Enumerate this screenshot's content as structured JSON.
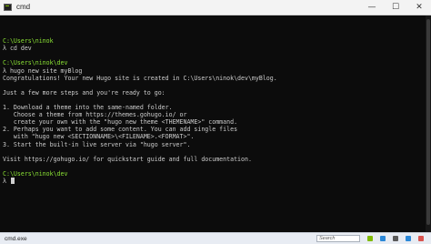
{
  "window": {
    "title": "cmd",
    "controls": {
      "minimize": "—",
      "maximize": "☐",
      "close": "✕"
    }
  },
  "terminal": {
    "lines": [
      {
        "path": "C:\\Users\\ninok",
        "text": ""
      },
      {
        "path": "",
        "text": "λ cd dev"
      },
      {
        "path": "",
        "text": ""
      },
      {
        "path": "C:\\Users\\ninok\\dev",
        "text": ""
      },
      {
        "path": "",
        "text": "λ hugo new site myBlog"
      },
      {
        "path": "",
        "text": "Congratulations! Your new Hugo site is created in C:\\Users\\ninok\\dev\\myBlog."
      },
      {
        "path": "",
        "text": ""
      },
      {
        "path": "",
        "text": "Just a few more steps and you're ready to go:"
      },
      {
        "path": "",
        "text": ""
      },
      {
        "path": "",
        "text": "1. Download a theme into the same-named folder."
      },
      {
        "path": "",
        "text": "   Choose a theme from https://themes.gohugo.io/ or"
      },
      {
        "path": "",
        "text": "   create your own with the \"hugo new theme <THEMENAME>\" command."
      },
      {
        "path": "",
        "text": "2. Perhaps you want to add some content. You can add single files"
      },
      {
        "path": "",
        "text": "   with \"hugo new <SECTIONNAME>\\<FILENAME>.<FORMAT>\"."
      },
      {
        "path": "",
        "text": "3. Start the built-in live server via \"hugo server\"."
      },
      {
        "path": "",
        "text": ""
      },
      {
        "path": "",
        "text": "Visit https://gohugo.io/ for quickstart guide and full documentation."
      },
      {
        "path": "",
        "text": ""
      },
      {
        "path": "C:\\Users\\ninok\\dev",
        "text": ""
      }
    ],
    "prompt_symbol": "λ"
  },
  "taskbar": {
    "active_task": "cmd.exe",
    "search_placeholder": "Search",
    "tray_colors": [
      "#7fba00",
      "#2b88d8",
      "#5a5a5a",
      "#2b88d8",
      "#d9534f"
    ]
  }
}
